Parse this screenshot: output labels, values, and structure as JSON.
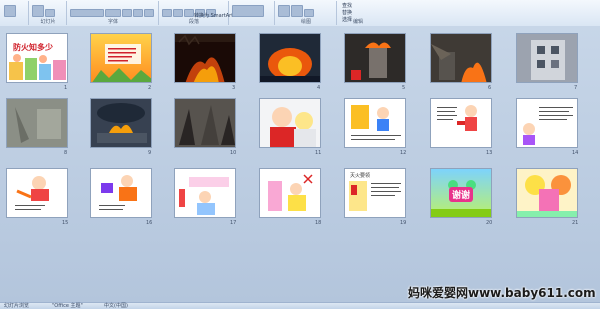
{
  "ribbon": {
    "group_labels": [
      "",
      "幻灯片",
      "字体",
      "段落",
      "",
      "绘图",
      "编辑"
    ],
    "small_text": [
      "转换为 SmartArt",
      "查找",
      "替换",
      "选择"
    ]
  },
  "slides": [
    {
      "num": "1",
      "title": "防火知多少"
    },
    {
      "num": "2"
    },
    {
      "num": "3"
    },
    {
      "num": "4"
    },
    {
      "num": "5"
    },
    {
      "num": "6"
    },
    {
      "num": "7"
    },
    {
      "num": "8"
    },
    {
      "num": "9"
    },
    {
      "num": "10"
    },
    {
      "num": "11"
    },
    {
      "num": "12"
    },
    {
      "num": "13"
    },
    {
      "num": "14"
    },
    {
      "num": "15"
    },
    {
      "num": "16"
    },
    {
      "num": "17"
    },
    {
      "num": "18"
    },
    {
      "num": "19",
      "header": "灭火要领"
    },
    {
      "num": "20",
      "title": "谢谢"
    },
    {
      "num": "21"
    }
  ],
  "status": {
    "left": "幻灯片浏览",
    "theme": "\"Office 主题\"",
    "lang": "中文(中国)"
  },
  "watermark": "妈咪爱婴网www.baby611.com",
  "colors": {
    "ribbon": "#dae6f4",
    "sorter_bg": "#b9c9dd",
    "title_red": "#d0222c",
    "accent_pink": "#e8338b"
  }
}
